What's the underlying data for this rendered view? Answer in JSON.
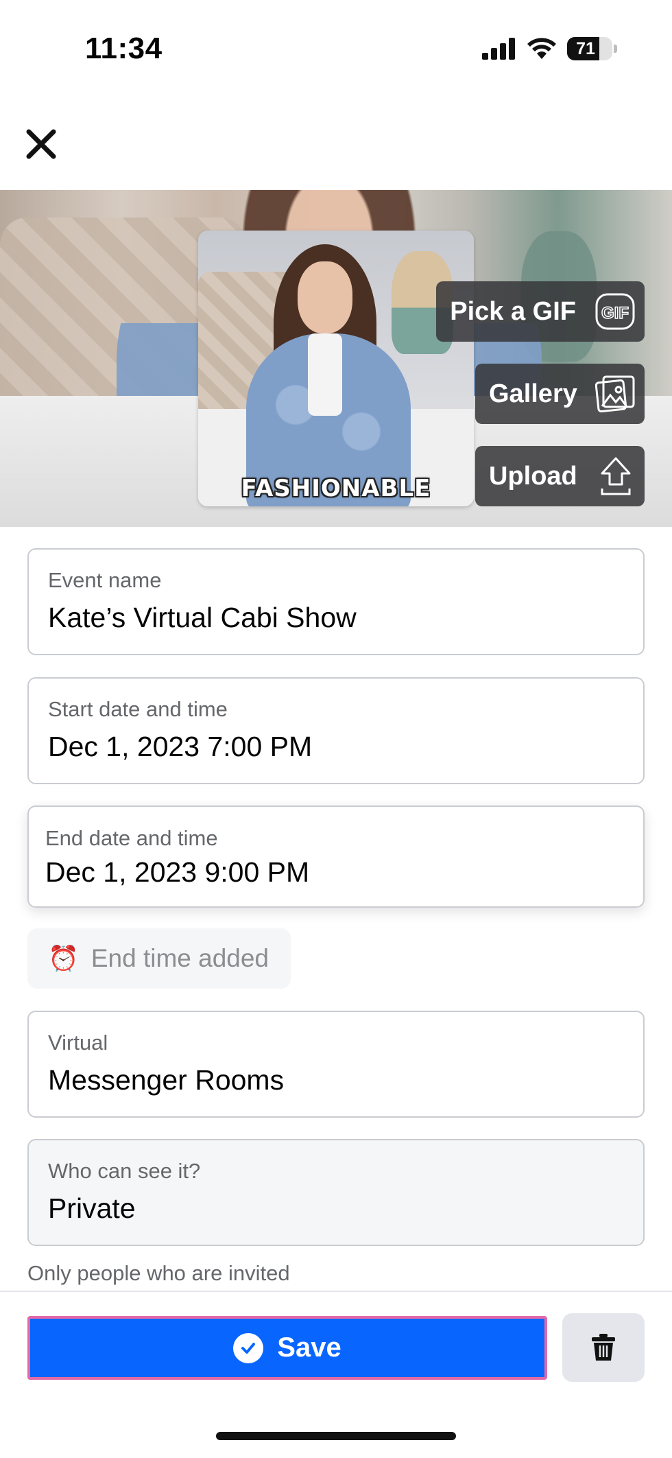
{
  "status_bar": {
    "time": "11:34",
    "battery": "71",
    "battery_level": 0.71
  },
  "header": {
    "close_icon": "close-icon"
  },
  "cover": {
    "caption": "FASHIONABLE",
    "buttons": [
      {
        "label": "Pick a GIF",
        "icon": "gif-icon"
      },
      {
        "label": "Gallery",
        "icon": "gallery-icon"
      },
      {
        "label": "Upload",
        "icon": "upload-icon"
      }
    ]
  },
  "form": {
    "event_name": {
      "label": "Event name",
      "value": "Kate’s Virtual Cabi Show"
    },
    "start": {
      "label": "Start date and time",
      "value": "Dec 1, 2023 7:00 PM"
    },
    "end": {
      "label": "End date and time",
      "value": "Dec 1, 2023 9:00 PM"
    },
    "end_chip": {
      "icon": "⏰",
      "label": "End time added"
    },
    "location": {
      "label": "Virtual",
      "value": "Messenger Rooms"
    },
    "privacy": {
      "label": "Who can see it?",
      "value": "Private",
      "helper": "Only people who are invited"
    }
  },
  "footer": {
    "save_label": "Save",
    "delete_icon": "trash-icon"
  },
  "colors": {
    "primary": "#0866ff",
    "highlight": "#e06aa8",
    "secondary_text": "#65676b"
  }
}
